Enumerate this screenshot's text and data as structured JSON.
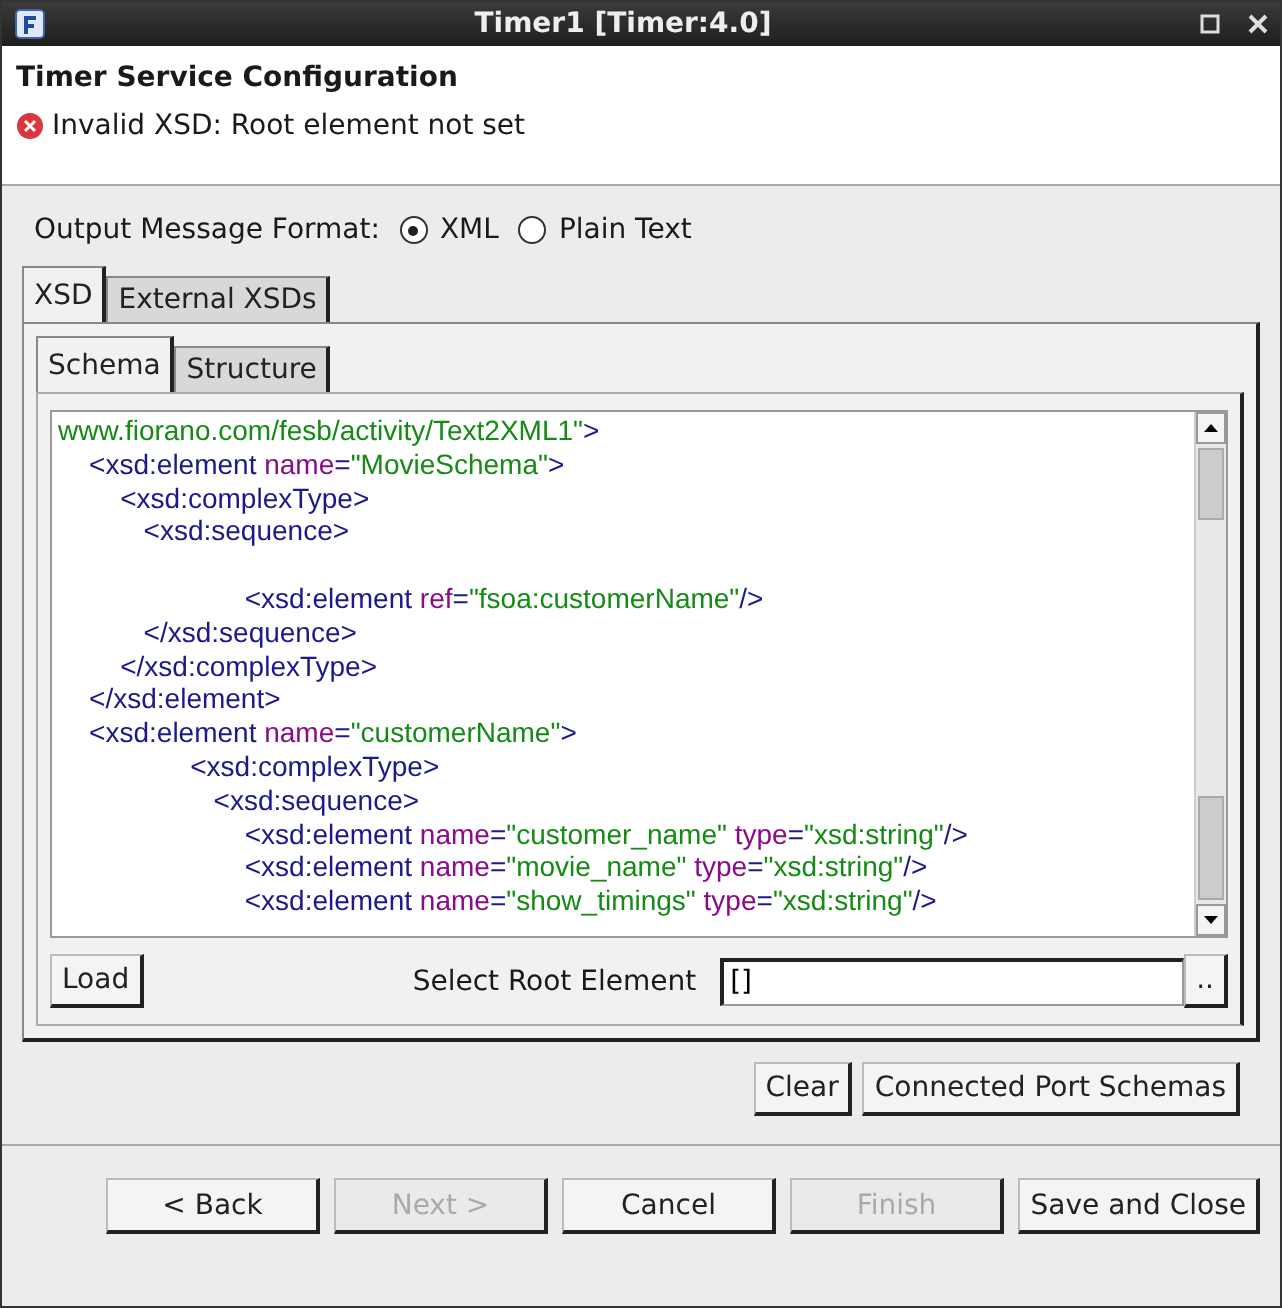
{
  "window": {
    "title": "Timer1 [Timer:4.0]"
  },
  "header": {
    "title": "Timer Service Configuration",
    "error": "Invalid XSD: Root element not set"
  },
  "output_format": {
    "label": "Output Message Format:",
    "options": [
      {
        "label": "XML",
        "selected": true
      },
      {
        "label": "Plain Text",
        "selected": false
      }
    ]
  },
  "outer_tabs": [
    {
      "label": "XSD",
      "selected": true
    },
    {
      "label": "External XSDs",
      "selected": false
    }
  ],
  "inner_tabs": [
    {
      "label": "Schema",
      "selected": true
    },
    {
      "label": "Structure",
      "selected": false
    }
  ],
  "code_lines": [
    {
      "kind": "code",
      "segments": [
        {
          "kind": "value",
          "text": "www.fiorano.com/fesb/activity/Text2XML1\""
        },
        {
          "kind": "tag",
          "text": ">"
        }
      ]
    },
    {
      "kind": "code",
      "segments": [
        {
          "kind": "tag",
          "text": "    <xsd:element "
        },
        {
          "kind": "attr",
          "text": "name"
        },
        {
          "kind": "tag",
          "text": "="
        },
        {
          "kind": "value",
          "text": "\"MovieSchema\""
        },
        {
          "kind": "tag",
          "text": ">"
        }
      ]
    },
    {
      "kind": "code",
      "segments": [
        {
          "kind": "tag",
          "text": "        <xsd:complexType>"
        }
      ]
    },
    {
      "kind": "code",
      "segments": [
        {
          "kind": "tag",
          "text": "           <xsd:sequence>"
        }
      ]
    },
    {
      "kind": "blank"
    },
    {
      "kind": "code",
      "segments": [
        {
          "kind": "tag",
          "text": "                        <xsd:element "
        },
        {
          "kind": "attr",
          "text": "ref"
        },
        {
          "kind": "tag",
          "text": "="
        },
        {
          "kind": "value",
          "text": "\"fsoa:customerName\""
        },
        {
          "kind": "tag",
          "text": "/>"
        }
      ]
    },
    {
      "kind": "code",
      "segments": [
        {
          "kind": "tag",
          "text": "           </xsd:sequence>"
        }
      ]
    },
    {
      "kind": "code",
      "segments": [
        {
          "kind": "tag",
          "text": "        </xsd:complexType>"
        }
      ]
    },
    {
      "kind": "code",
      "segments": [
        {
          "kind": "tag",
          "text": "    </xsd:element>"
        }
      ]
    },
    {
      "kind": "code",
      "segments": [
        {
          "kind": "tag",
          "text": "    <xsd:element "
        },
        {
          "kind": "attr",
          "text": "name"
        },
        {
          "kind": "tag",
          "text": "="
        },
        {
          "kind": "value",
          "text": "\"customerName\""
        },
        {
          "kind": "tag",
          "text": ">"
        }
      ]
    },
    {
      "kind": "code",
      "segments": [
        {
          "kind": "tag",
          "text": "                 <xsd:complexType>"
        }
      ]
    },
    {
      "kind": "code",
      "segments": [
        {
          "kind": "tag",
          "text": "                    <xsd:sequence>"
        }
      ]
    },
    {
      "kind": "code",
      "segments": [
        {
          "kind": "tag",
          "text": "                        <xsd:element "
        },
        {
          "kind": "attr",
          "text": "name"
        },
        {
          "kind": "tag",
          "text": "="
        },
        {
          "kind": "value",
          "text": "\"customer_name\""
        },
        {
          "kind": "attr",
          "text": " type"
        },
        {
          "kind": "tag",
          "text": "="
        },
        {
          "kind": "value",
          "text": "\"xsd:string\""
        },
        {
          "kind": "tag",
          "text": "/>"
        }
      ]
    },
    {
      "kind": "code",
      "segments": [
        {
          "kind": "tag",
          "text": "                        <xsd:element "
        },
        {
          "kind": "attr",
          "text": "name"
        },
        {
          "kind": "tag",
          "text": "="
        },
        {
          "kind": "value",
          "text": "\"movie_name\""
        },
        {
          "kind": "attr",
          "text": " type"
        },
        {
          "kind": "tag",
          "text": "="
        },
        {
          "kind": "value",
          "text": "\"xsd:string\""
        },
        {
          "kind": "tag",
          "text": "/>"
        }
      ]
    },
    {
      "kind": "code",
      "segments": [
        {
          "kind": "tag",
          "text": "                        <xsd:element "
        },
        {
          "kind": "attr",
          "text": "name"
        },
        {
          "kind": "tag",
          "text": "="
        },
        {
          "kind": "value",
          "text": "\"show_timings\""
        },
        {
          "kind": "attr",
          "text": " type"
        },
        {
          "kind": "tag",
          "text": "="
        },
        {
          "kind": "value",
          "text": "\"xsd:string\""
        },
        {
          "kind": "tag",
          "text": "/>"
        }
      ]
    }
  ],
  "load_button": "Load",
  "root_element": {
    "label": "Select Root Element",
    "value": "[]",
    "browse": ".."
  },
  "schema_buttons": [
    "Clear",
    "Connected Port Schemas"
  ],
  "footer_buttons": [
    {
      "label": "< Back",
      "disabled": false
    },
    {
      "label": "Next >",
      "disabled": true
    },
    {
      "label": "Cancel",
      "disabled": false
    },
    {
      "label": "Finish",
      "disabled": true
    },
    {
      "label": "Save and Close",
      "disabled": false
    }
  ]
}
